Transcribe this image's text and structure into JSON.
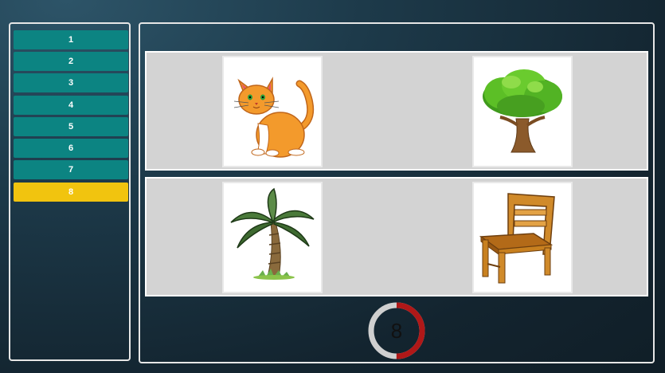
{
  "sidebar": {
    "items": [
      {
        "label": "1"
      },
      {
        "label": "2"
      },
      {
        "label": "3"
      },
      {
        "label": "4"
      },
      {
        "label": "5"
      },
      {
        "label": "6"
      },
      {
        "label": "7"
      },
      {
        "label": "8",
        "active": true
      }
    ]
  },
  "choices": [
    {
      "name": "cat"
    },
    {
      "name": "tree"
    },
    {
      "name": "palm-tree"
    },
    {
      "name": "chair"
    }
  ],
  "timer": {
    "value": "8",
    "fraction_remaining": 0.5,
    "ring_color": "#b01818",
    "track_color": "#cfcfcf"
  },
  "colors": {
    "button": "#0c8482",
    "button_active": "#f1c40f",
    "panel_border": "#e6e6e6",
    "row_background": "#d3d3d3"
  }
}
